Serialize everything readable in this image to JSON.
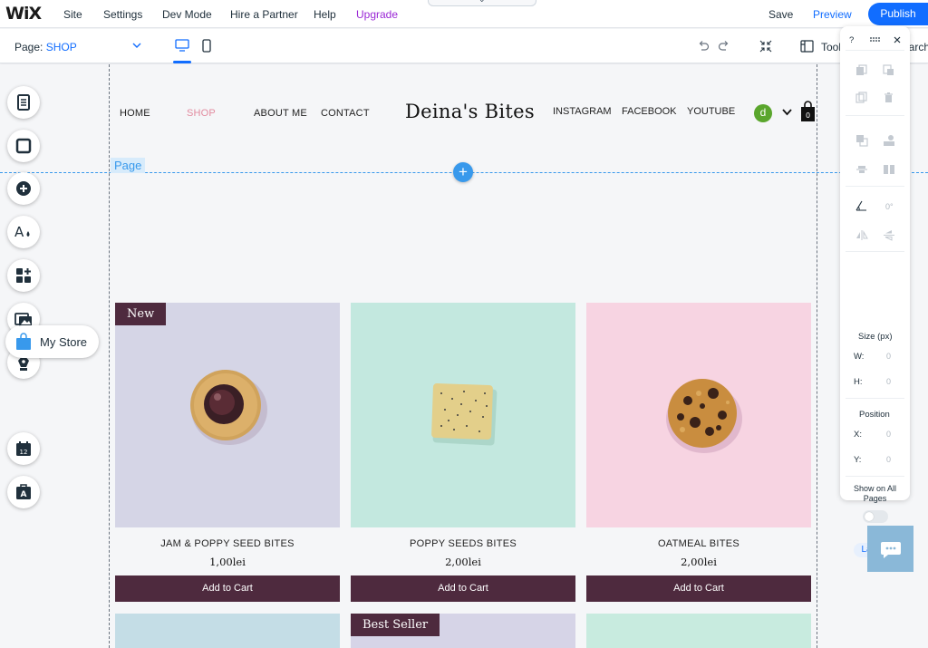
{
  "topbar": {
    "logo": "WiX",
    "menu": [
      "Site",
      "Settings",
      "Dev Mode",
      "Hire a Partner",
      "Help"
    ],
    "upgrade": "Upgrade",
    "save": "Save",
    "preview": "Preview",
    "publish": "Publish",
    "tab_handle_icon": "chevron-down-icon"
  },
  "subbar": {
    "page_label": "Page:",
    "page_value": "SHOP",
    "devices": [
      "desktop",
      "mobile"
    ],
    "active_device": "desktop",
    "tools": "Tools",
    "search": "Search"
  },
  "canvas": {
    "page_tag": "Page",
    "add_section": "+",
    "accent_color": "#3899ec"
  },
  "site": {
    "nav": [
      "HOME",
      "SHOP",
      "ABOUT ME",
      "CONTACT"
    ],
    "active_nav": "SHOP",
    "title": "Deina's Bites",
    "social": [
      "INSTAGRAM",
      "FACEBOOK",
      "YOUTUBE"
    ],
    "user_initial": "d",
    "cart_count": "0",
    "brand_color": "#4e2a3e",
    "nav_active_color": "#e28b9f"
  },
  "products": [
    {
      "name": "JAM & POPPY SEED BITES",
      "price": "1,00lei",
      "button": "Add to Cart",
      "badge": "New",
      "bg": "#d5d5e6"
    },
    {
      "name": "POPPY SEEDS BITES",
      "price": "2,00lei",
      "button": "Add to Cart",
      "badge": "",
      "bg": "#c3e8df"
    },
    {
      "name": "OATMEAL BITES",
      "price": "2,00lei",
      "button": "Add to Cart",
      "badge": "",
      "bg": "#f7d4e2"
    }
  ],
  "products_row2": [
    {
      "badge": "",
      "bg": "#c4dde6"
    },
    {
      "badge": "Best Seller",
      "bg": "#d6d4e7"
    },
    {
      "badge": "",
      "bg": "#c8ebdf"
    }
  ],
  "left_toolbar": {
    "buttons": [
      "pages-icon",
      "background-icon",
      "add-icon",
      "theme-icon",
      "apps-icon",
      "media-icon",
      "blog-icon",
      "store-icon",
      "bookings-icon",
      "ascend-icon"
    ],
    "my_store_label": "My Store"
  },
  "right_panel": {
    "help": "?",
    "rotation": "0°",
    "size_label": "Size (px)",
    "w_label": "W:",
    "w_value": "0",
    "h_label": "H:",
    "h_value": "0",
    "position_label": "Position",
    "x_label": "X:",
    "x_value": "0",
    "y_label": "Y:",
    "y_value": "0",
    "show_on_all_pages": "Show on All Pages",
    "show_on_all_pages_on": false,
    "layers": "Layers"
  },
  "chat_icon": "chat-icon"
}
